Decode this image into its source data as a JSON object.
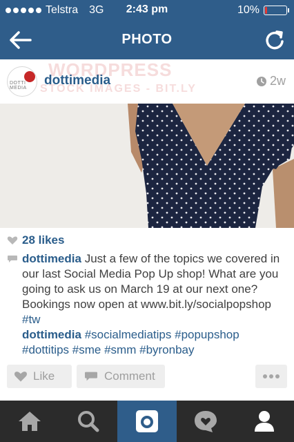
{
  "status_bar": {
    "carrier": "Telstra",
    "network": "3G",
    "time": "2:43 pm",
    "battery_percent": "10%",
    "battery_level": 0.1,
    "battery_color": "#e53935"
  },
  "nav": {
    "title": "PHOTO",
    "back_icon": "back-arrow-icon",
    "refresh_icon": "refresh-icon"
  },
  "post": {
    "username": "dottimedia",
    "time_ago": "2w",
    "watermark_line1": "WORDPRESS",
    "watermark_line2": "STOCK IMAGES - BIT.LY",
    "avatar_text": "DOTTI MEDIA",
    "likes": "28 likes",
    "caption_user": "dottimedia",
    "caption_body": "Just a few of the topics we covered in our last Social Media Pop Up shop! What are you going to ask us on March 19 at our next one? Bookings now open at www.bit.ly/socialpopshop",
    "caption_tag": "#tw",
    "tags_user": "dottimedia",
    "tags": [
      "#socialmediatips",
      "#popupshop",
      "#dottitips",
      "#sme",
      "#smm",
      "#byronbay"
    ]
  },
  "actions": {
    "like_label": "Like",
    "comment_label": "Comment"
  },
  "tab_bar": {
    "items": [
      {
        "icon": "home-icon"
      },
      {
        "icon": "search-icon"
      },
      {
        "icon": "camera-icon"
      },
      {
        "icon": "activity-icon"
      },
      {
        "icon": "profile-icon"
      }
    ],
    "active_index": 2
  },
  "colors": {
    "header_blue": "#2f5d8a",
    "link_blue": "#2a5d8b",
    "tab_bar_dark": "#2b2b2b"
  }
}
